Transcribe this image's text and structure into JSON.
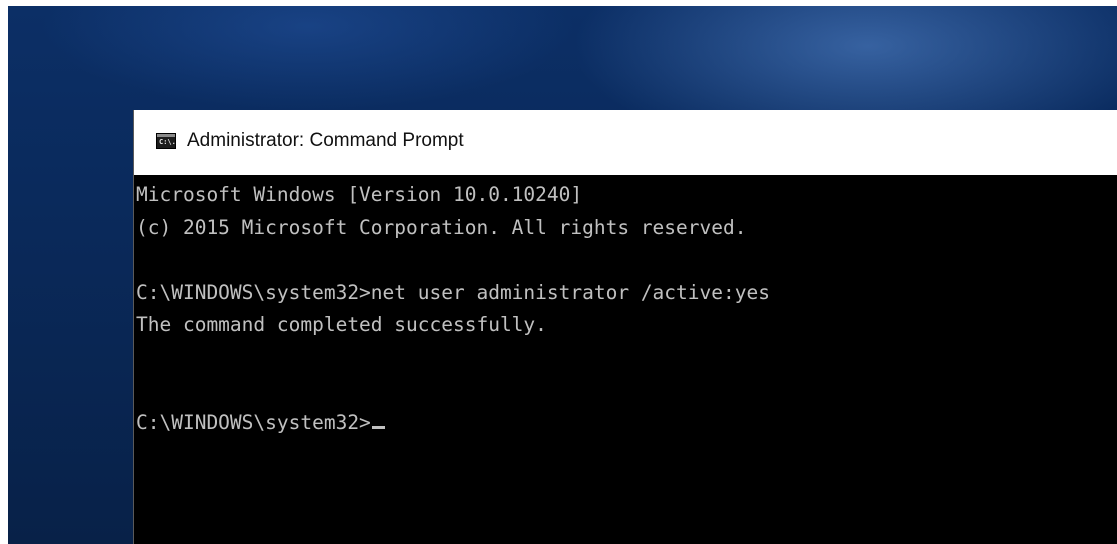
{
  "window": {
    "title": "Administrator: Command Prompt",
    "icon": "cmd-icon",
    "icon_glyph": "C:\\."
  },
  "console": {
    "lines": [
      "Microsoft Windows [Version 10.0.10240]",
      "(c) 2015 Microsoft Corporation. All rights reserved.",
      "",
      "C:\\WINDOWS\\system32>net user administrator /active:yes",
      "The command completed successfully.",
      "",
      ""
    ],
    "prompt": "C:\\WINDOWS\\system32>"
  },
  "colors": {
    "console_background": "#000000",
    "console_text": "#c0c0c0",
    "titlebar_background": "#ffffff",
    "desktop_blue": "#0a2a5c"
  }
}
